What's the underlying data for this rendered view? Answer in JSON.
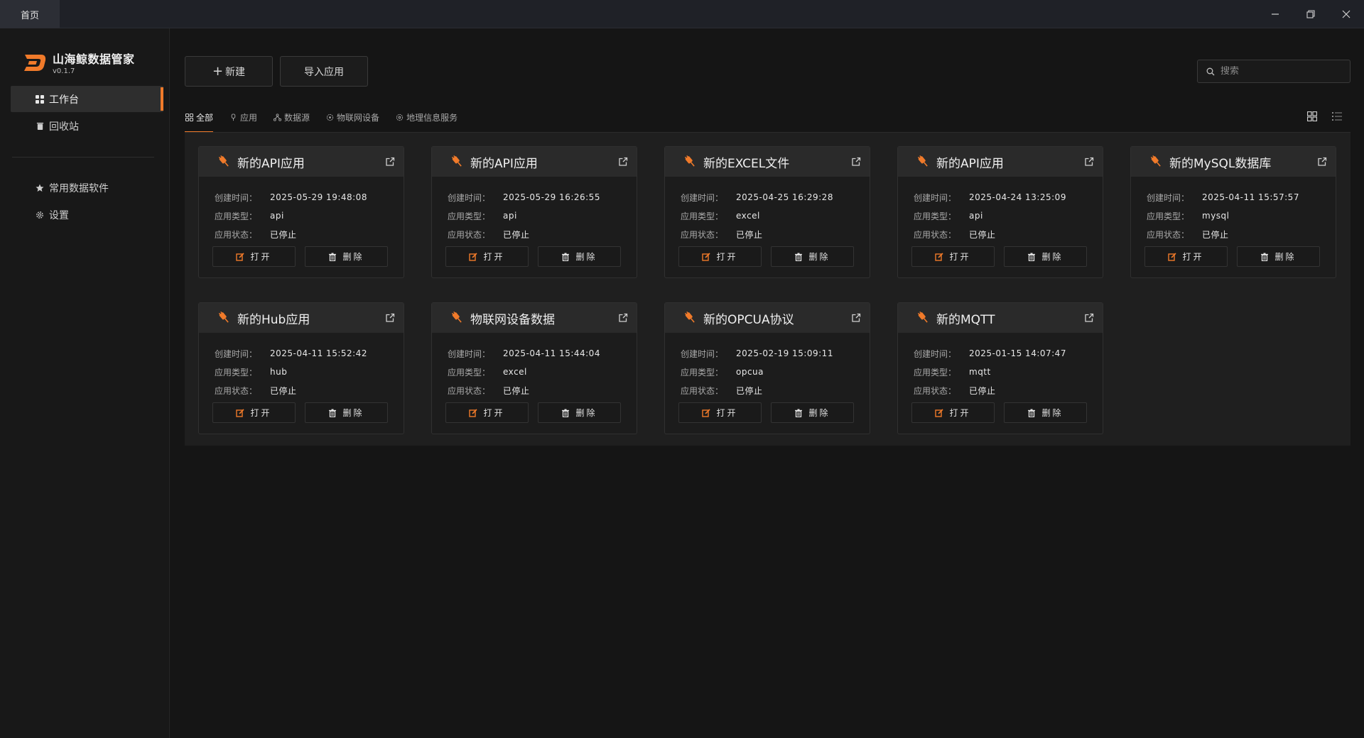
{
  "titlebar": {
    "home_tab": "首页"
  },
  "sidebar": {
    "app_name": "山海鲸数据管家",
    "version": "v0.1.7",
    "items": [
      {
        "label": "工作台",
        "icon": "grid-icon",
        "active": true
      },
      {
        "label": "回收站",
        "icon": "trash-icon",
        "active": false
      },
      {
        "label": "常用数据软件",
        "icon": "star-icon",
        "active": false
      },
      {
        "label": "设置",
        "icon": "gear-icon",
        "active": false
      }
    ]
  },
  "toolbar": {
    "new_label": "新建",
    "import_label": "导入应用",
    "search_placeholder": "搜索"
  },
  "filters": [
    {
      "label": "全部",
      "icon": "grid-icon",
      "active": true
    },
    {
      "label": "应用",
      "icon": "plug-icon",
      "active": false
    },
    {
      "label": "数据源",
      "icon": "network-icon",
      "active": false
    },
    {
      "label": "物联网设备",
      "icon": "iot-icon",
      "active": false
    },
    {
      "label": "地理信息服务",
      "icon": "globe-icon",
      "active": false
    }
  ],
  "card_labels": {
    "created": "创建时间：",
    "type": "应用类型：",
    "status": "应用状态：",
    "open": "打开",
    "delete": "删除"
  },
  "cards": [
    {
      "title": "新的API应用",
      "created": "2025-05-29 19:48:08",
      "type": "api",
      "status": "已停止"
    },
    {
      "title": "新的API应用",
      "created": "2025-05-29 16:26:55",
      "type": "api",
      "status": "已停止"
    },
    {
      "title": "新的EXCEL文件",
      "created": "2025-04-25 16:29:28",
      "type": "excel",
      "status": "已停止"
    },
    {
      "title": "新的API应用",
      "created": "2025-04-24 13:25:09",
      "type": "api",
      "status": "已停止"
    },
    {
      "title": "新的MySQL数据库",
      "created": "2025-04-11 15:57:57",
      "type": "mysql",
      "status": "已停止"
    },
    {
      "title": "新的Hub应用",
      "created": "2025-04-11 15:52:42",
      "type": "hub",
      "status": "已停止"
    },
    {
      "title": "物联网设备数据",
      "created": "2025-04-11 15:44:04",
      "type": "excel",
      "status": "已停止"
    },
    {
      "title": "新的OPCUA协议",
      "created": "2025-02-19 15:09:11",
      "type": "opcua",
      "status": "已停止"
    },
    {
      "title": "新的MQTT",
      "created": "2025-01-15 14:07:47",
      "type": "mqtt",
      "status": "已停止"
    }
  ],
  "colors": {
    "accent": "#f07a2a",
    "background": "#151515",
    "card_header": "#2a2a2a"
  }
}
